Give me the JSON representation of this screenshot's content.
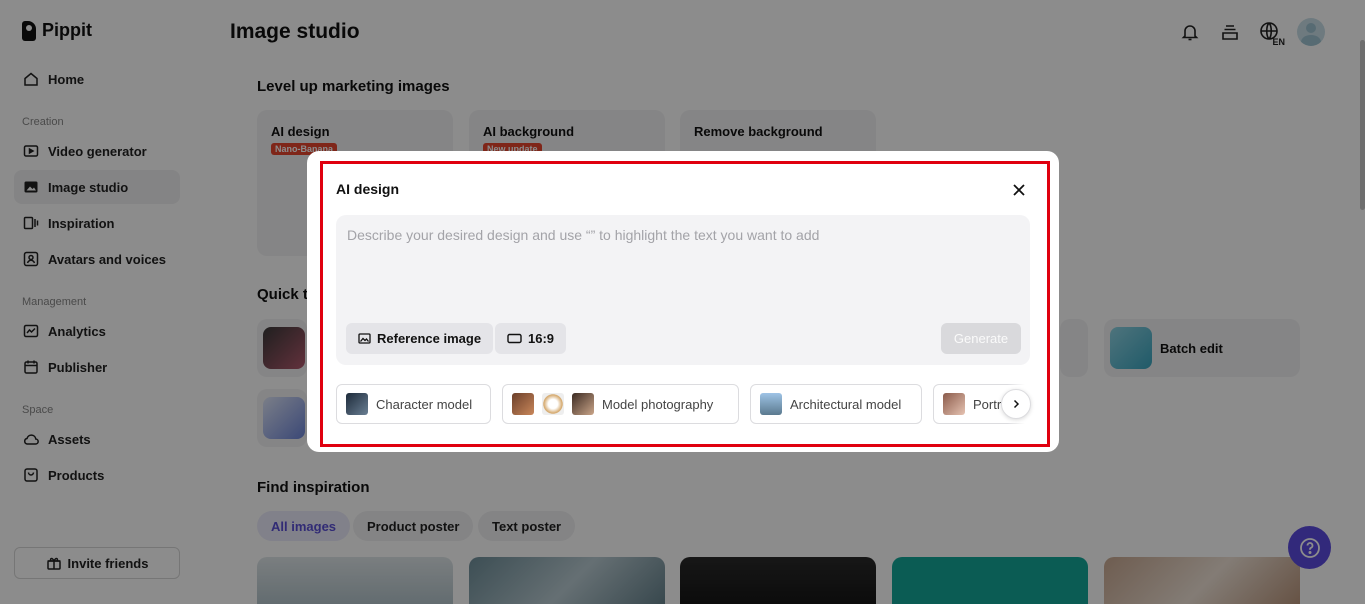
{
  "app": {
    "name": "Pippit"
  },
  "sidebar": {
    "home": "Home",
    "creation_label": "Creation",
    "creation_items": [
      "Video generator",
      "Image studio",
      "Inspiration",
      "Avatars and voices"
    ],
    "management_label": "Management",
    "management_items": [
      "Analytics",
      "Publisher"
    ],
    "space_label": "Space",
    "space_items": [
      "Assets",
      "Products"
    ],
    "invite": "Invite friends"
  },
  "header": {
    "title": "Image studio",
    "language": "EN"
  },
  "main": {
    "section_level_up": "Level up marketing images",
    "feature_cards": [
      {
        "title": "AI design",
        "badge": "Nano-Banana"
      },
      {
        "title": "AI background",
        "badge": "New update"
      },
      {
        "title": "Remove background",
        "badge": ""
      }
    ],
    "section_quick": "Quick tools",
    "quick_tools": [
      "Batch edit"
    ],
    "section_find": "Find inspiration",
    "filter_chips": [
      "All images",
      "Product poster",
      "Text poster"
    ]
  },
  "modal": {
    "title": "AI design",
    "prompt_placeholder": "Describe your desired design and use “” to highlight the text you want to add",
    "reference_button": "Reference image",
    "ratio_button": "16:9",
    "generate_button": "Generate",
    "templates": [
      "Character model",
      "Model photography",
      "Architectural model",
      "Portrait"
    ]
  },
  "colors": {
    "accent": "#5b4ce0",
    "highlight_frame": "#e0000f",
    "badge": "#e8462f"
  }
}
